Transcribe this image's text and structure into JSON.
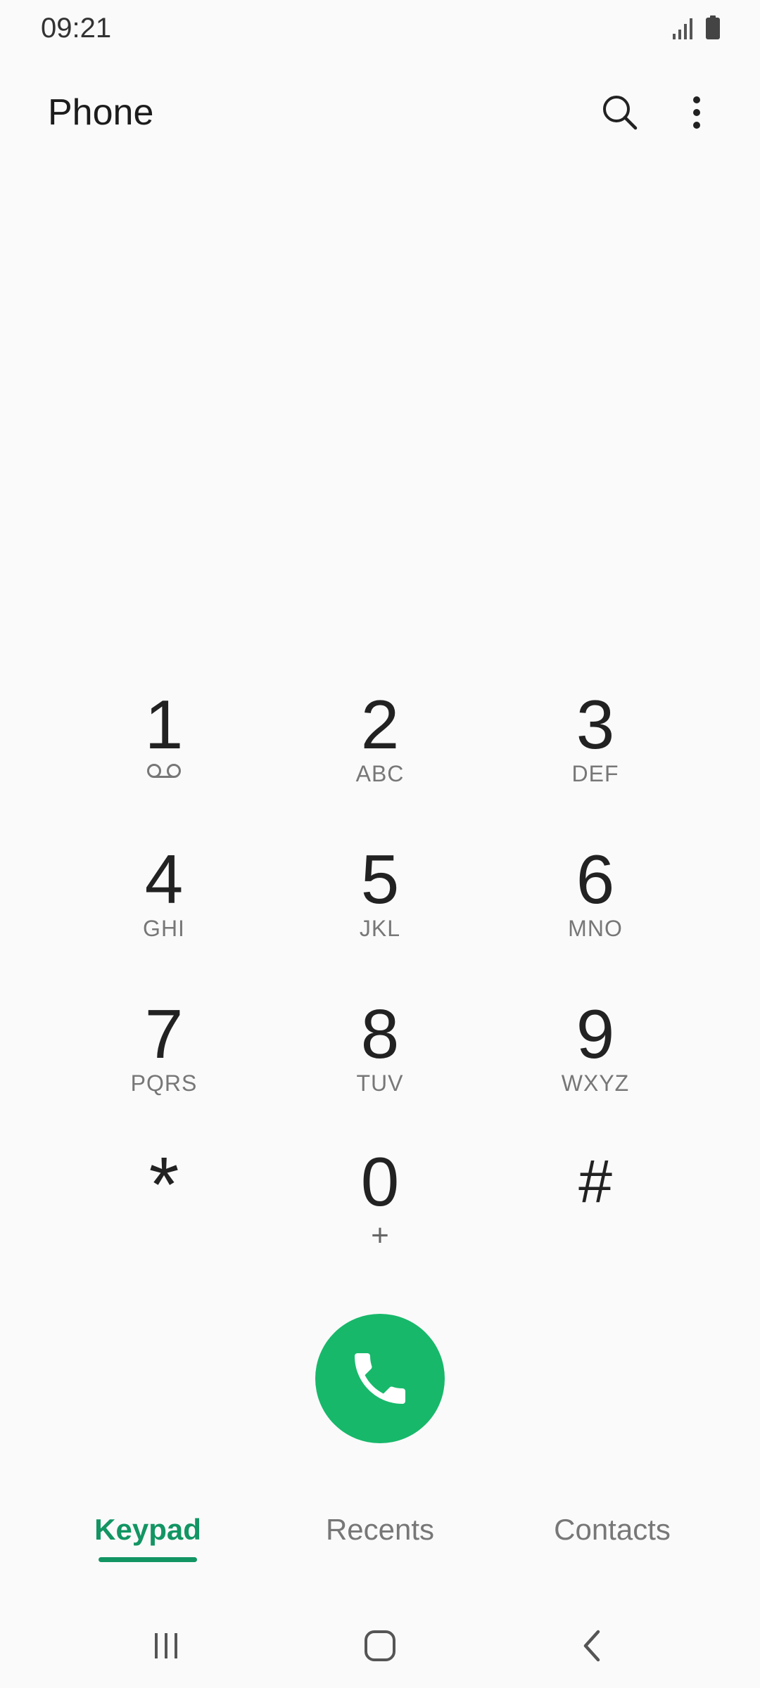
{
  "status_bar": {
    "time": "09:21"
  },
  "app_bar": {
    "title": "Phone"
  },
  "keypad": {
    "keys": [
      {
        "digit": "1",
        "letters": ""
      },
      {
        "digit": "2",
        "letters": "ABC"
      },
      {
        "digit": "3",
        "letters": "DEF"
      },
      {
        "digit": "4",
        "letters": "GHI"
      },
      {
        "digit": "5",
        "letters": "JKL"
      },
      {
        "digit": "6",
        "letters": "MNO"
      },
      {
        "digit": "7",
        "letters": "PQRS"
      },
      {
        "digit": "8",
        "letters": "TUV"
      },
      {
        "digit": "9",
        "letters": "WXYZ"
      },
      {
        "digit": "*",
        "letters": ""
      },
      {
        "digit": "0",
        "letters": "+"
      },
      {
        "digit": "#",
        "letters": ""
      }
    ]
  },
  "call_button": {
    "icon": "phone-icon",
    "color": "#17b86a"
  },
  "tabs": [
    {
      "label": "Keypad",
      "active": true
    },
    {
      "label": "Recents",
      "active": false
    },
    {
      "label": "Contacts",
      "active": false
    }
  ],
  "accent_color": "#129563"
}
